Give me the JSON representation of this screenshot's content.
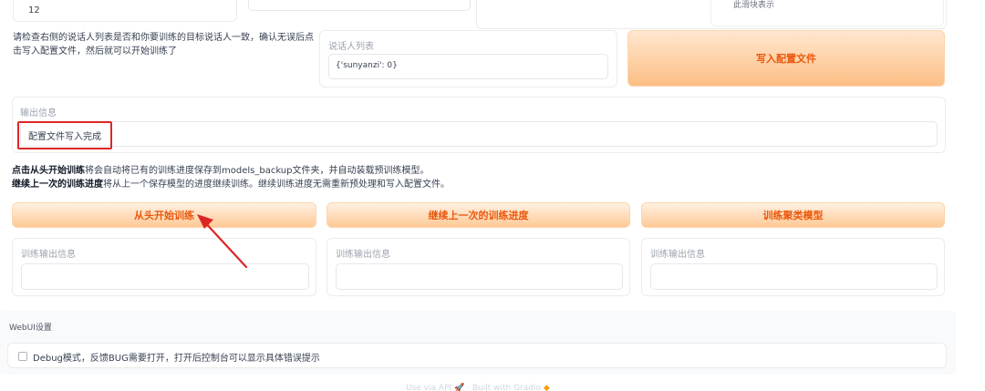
{
  "top": {
    "number_value": "12",
    "right_text": "此滑块表示"
  },
  "info_text": "请检查右侧的说话人列表是否和你要训练的目标说话人一致，确认无误后点击写入配置文件，然后就可以开始训练了",
  "speaker_list": {
    "label": "说话人列表",
    "value": "{'sunyanzi': 0}"
  },
  "write_config_button": "写入配置文件",
  "output": {
    "label": "输出信息",
    "value": "配置文件写入完成"
  },
  "train_hint": {
    "line1_bold": "点击从头开始训练",
    "line1_rest": "将会自动将已有的训练进度保存到models_backup文件夹，并自动装载预训练模型。",
    "line2_bold": "继续上一次的训练进度",
    "line2_rest": "将从上一个保存模型的进度继续训练。继续训练进度无需重新预处理和写入配置文件。"
  },
  "buttons": {
    "train_scratch": "从头开始训练",
    "continue_train": "继续上一次的训练进度",
    "train_cluster": "训练聚类模型"
  },
  "train_outputs": [
    {
      "label": "训练输出信息",
      "value": ""
    },
    {
      "label": "训练输出信息",
      "value": ""
    },
    {
      "label": "训练输出信息",
      "value": ""
    }
  ],
  "webui": {
    "title": "WebUI设置",
    "debug_label": "Debug模式，反馈BUG需要打开，打开后控制台可以显示具体错误提示",
    "debug_checked": false
  },
  "footer": {
    "api": "Use via API",
    "separator": "·",
    "built": "Built with Gradio"
  },
  "colors": {
    "accent": "#ea580c",
    "button_gradient_top": "#fff1e2",
    "button_gradient_bottom": "#fdc996",
    "highlight_red": "#dc2626"
  }
}
